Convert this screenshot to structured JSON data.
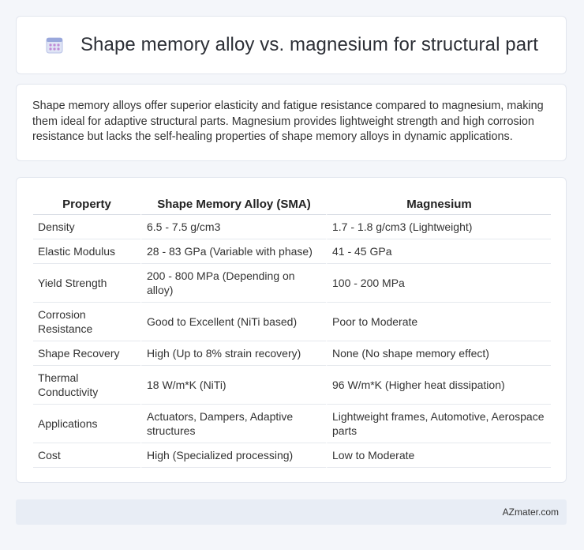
{
  "header": {
    "title": "Shape memory alloy vs. magnesium for structural part",
    "icon": "calendar-grid-icon"
  },
  "summary": {
    "text": "Shape memory alloys offer superior elasticity and fatigue resistance compared to magnesium, making them ideal for adaptive structural parts. Magnesium provides lightweight strength and high corrosion resistance but lacks the self-healing properties of shape memory alloys in dynamic applications."
  },
  "table": {
    "headers": [
      "Property",
      "Shape Memory Alloy (SMA)",
      "Magnesium"
    ],
    "rows": [
      [
        "Density",
        "6.5 - 7.5 g/cm3",
        "1.7 - 1.8 g/cm3 (Lightweight)"
      ],
      [
        "Elastic Modulus",
        "28 - 83 GPa (Variable with phase)",
        "41 - 45 GPa"
      ],
      [
        "Yield Strength",
        "200 - 800 MPa (Depending on alloy)",
        "100 - 200 MPa"
      ],
      [
        "Corrosion Resistance",
        "Good to Excellent (NiTi based)",
        "Poor to Moderate"
      ],
      [
        "Shape Recovery",
        "High (Up to 8% strain recovery)",
        "None (No shape memory effect)"
      ],
      [
        "Thermal Conductivity",
        "18 W/m*K (NiTi)",
        "96 W/m*K (Higher heat dissipation)"
      ],
      [
        "Applications",
        "Actuators, Dampers, Adaptive structures",
        "Lightweight frames, Automotive, Aerospace parts"
      ],
      [
        "Cost",
        "High (Specialized processing)",
        "Low to Moderate"
      ]
    ]
  },
  "footer": {
    "brand": "AZmater.com"
  },
  "colors": {
    "background": "#f4f6fa",
    "card": "#ffffff",
    "footer": "#e8edf5",
    "icon_accent": "#8e7cc3"
  }
}
